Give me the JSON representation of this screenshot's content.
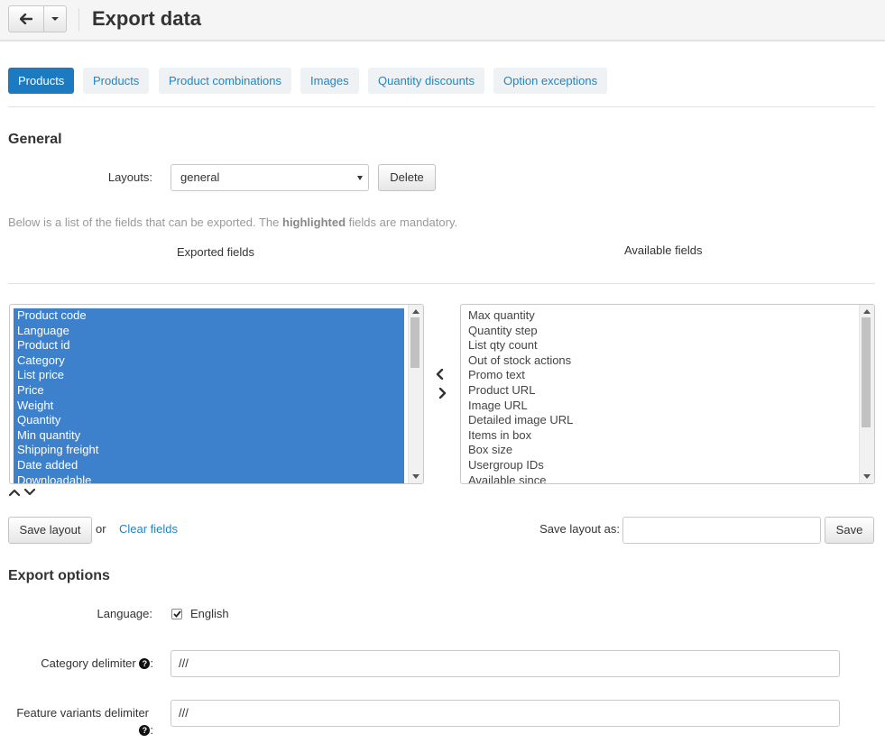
{
  "header": {
    "title": "Export data",
    "back_icon": "arrow-left-icon",
    "menu_icon": "caret-down-icon"
  },
  "tabs": [
    {
      "label": "Products",
      "active": true
    },
    {
      "label": "Products",
      "active": false
    },
    {
      "label": "Product combinations",
      "active": false
    },
    {
      "label": "Images",
      "active": false
    },
    {
      "label": "Quantity discounts",
      "active": false
    },
    {
      "label": "Option exceptions",
      "active": false
    }
  ],
  "general": {
    "title": "General",
    "layouts_label": "Layouts:",
    "layouts_value": "general",
    "delete_label": "Delete",
    "hint_before": "Below is a list of the fields that can be exported. The ",
    "hint_bold": "highlighted",
    "hint_after": " fields are mandatory.",
    "exported_title": "Exported fields",
    "available_title": "Available fields",
    "exported_fields": [
      "Product code",
      "Language",
      "Product id",
      "Category",
      "List price",
      "Price",
      "Weight",
      "Quantity",
      "Min quantity",
      "Shipping freight",
      "Date added",
      "Downloadable"
    ],
    "available_fields": [
      "Max quantity",
      "Quantity step",
      "List qty count",
      "Out of stock actions",
      "Promo text",
      "Product URL",
      "Image URL",
      "Detailed image URL",
      "Items in box",
      "Box size",
      "Usergroup IDs",
      "Available since"
    ],
    "save_layout_label": "Save layout",
    "or_text": "or",
    "clear_fields_label": "Clear fields",
    "save_as_label": "Save layout as:",
    "save_as_value": "",
    "save_label": "Save"
  },
  "export_options": {
    "title": "Export options",
    "language_label": "Language:",
    "language_value": "English",
    "language_checked": true,
    "category_delimiter_label": "Category delimiter",
    "category_delimiter_value": "///",
    "feature_delimiter_label": "Feature variants delimiter",
    "feature_delimiter_value": "///",
    "colon": ":"
  },
  "colors": {
    "accent": "#1b7ac0",
    "selection": "#3d81cc",
    "link": "#1e86c7"
  }
}
